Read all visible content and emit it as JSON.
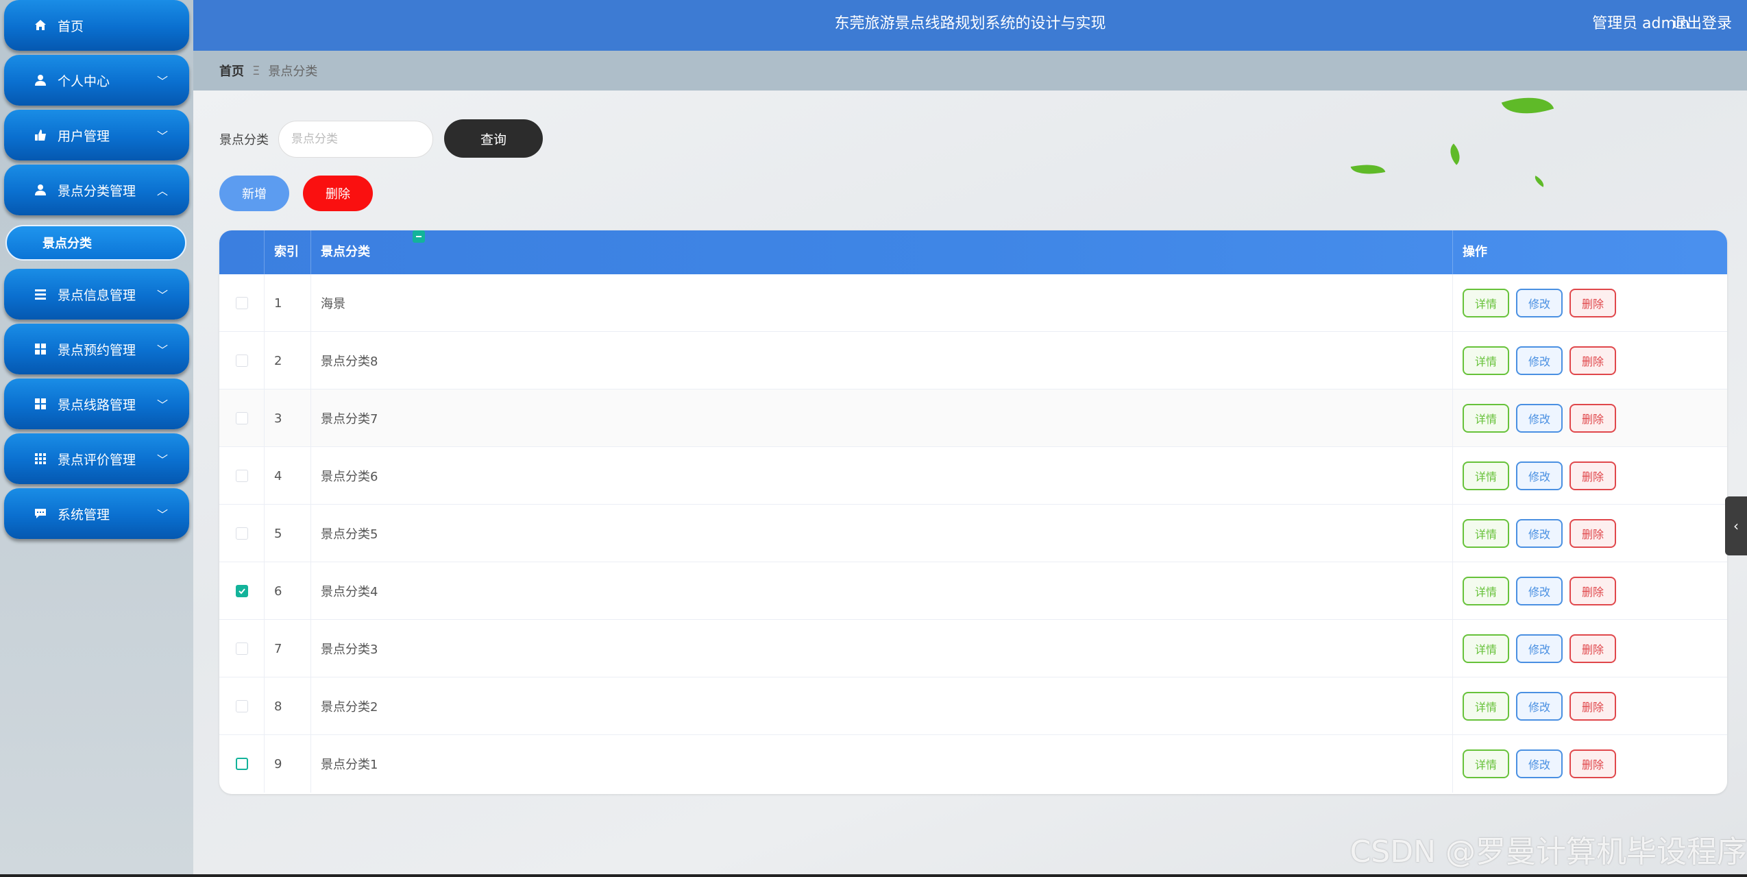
{
  "header": {
    "title": "东莞旅游景点线路规划系统的设计与实现",
    "user": "管理员 admin",
    "logout": "退出登录"
  },
  "sidebar": {
    "items": [
      {
        "label": "首页",
        "icon": "home-icon"
      },
      {
        "label": "个人中心",
        "icon": "user-icon"
      },
      {
        "label": "用户管理",
        "icon": "thumb-icon"
      },
      {
        "label": "景点分类管理",
        "icon": "user-icon"
      },
      {
        "label": "景点信息管理",
        "icon": "list-icon"
      },
      {
        "label": "景点预约管理",
        "icon": "grid-icon"
      },
      {
        "label": "景点线路管理",
        "icon": "grid-icon"
      },
      {
        "label": "景点评价管理",
        "icon": "grid9-icon"
      },
      {
        "label": "系统管理",
        "icon": "chat-icon"
      }
    ],
    "sub_item": "景点分类"
  },
  "breadcrumb": {
    "home": "首页",
    "separator": "Ξ",
    "current": "景点分类"
  },
  "search": {
    "label": "景点分类",
    "placeholder": "景点分类",
    "query_button": "查询"
  },
  "actions": {
    "add": "新增",
    "delete": "删除"
  },
  "table": {
    "columns": [
      "索引",
      "景点分类",
      "操作"
    ],
    "op_labels": {
      "detail": "详情",
      "edit": "修改",
      "remove": "删除"
    },
    "rows": [
      {
        "index": "1",
        "category": "海景",
        "checked": false
      },
      {
        "index": "2",
        "category": "景点分类8",
        "checked": false
      },
      {
        "index": "3",
        "category": "景点分类7",
        "checked": false
      },
      {
        "index": "4",
        "category": "景点分类6",
        "checked": false
      },
      {
        "index": "5",
        "category": "景点分类5",
        "checked": false
      },
      {
        "index": "6",
        "category": "景点分类4",
        "checked": true
      },
      {
        "index": "7",
        "category": "景点分类3",
        "checked": false
      },
      {
        "index": "8",
        "category": "景点分类2",
        "checked": false
      },
      {
        "index": "9",
        "category": "景点分类1",
        "checked": false
      }
    ]
  },
  "watermark": "CSDN @罗曼计算机毕设程序",
  "colors": {
    "header": "#3d7bd3",
    "nav": "#0a6fcf",
    "accent_check": "#13b39a",
    "danger": "#fa1010",
    "add": "#5c9cf0"
  }
}
